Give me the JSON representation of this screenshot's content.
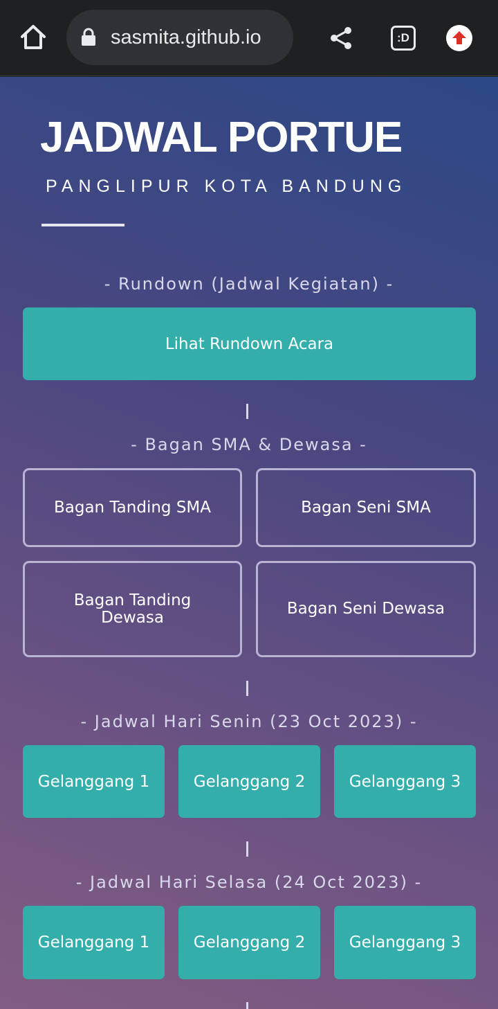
{
  "browser": {
    "url": "sasmita.github.io",
    "tab_count": ":D"
  },
  "page": {
    "title": "JADWAL PORTUE",
    "subtitle": "PANGLIPUR KOTA BANDUNG",
    "rundown": {
      "label": "- Rundown (Jadwal Kegiatan) -",
      "button": "Lihat Rundown Acara"
    },
    "bagan": {
      "label": "- Bagan SMA & Dewasa -",
      "buttons": [
        "Bagan Tanding SMA",
        "Bagan Seni SMA",
        "Bagan Tanding Dewasa",
        "Bagan Seni Dewasa"
      ]
    },
    "senin": {
      "label": "- Jadwal Hari Senin (23 Oct 2023) -",
      "buttons": [
        "Gelanggang 1",
        "Gelanggang 2",
        "Gelanggang 3"
      ]
    },
    "selasa": {
      "label": "- Jadwal Hari Selasa (24 Oct 2023) -",
      "buttons": [
        "Gelanggang 1",
        "Gelanggang 2",
        "Gelanggang 3"
      ]
    }
  },
  "colors": {
    "accent_button": "#33aeab",
    "gradient_top": "#2c4886",
    "gradient_bottom": "#825d82",
    "toolbar": "#1f2022"
  },
  "icons": [
    "home-icon",
    "lock-icon",
    "share-icon",
    "tab-switcher-icon",
    "update-icon"
  ]
}
